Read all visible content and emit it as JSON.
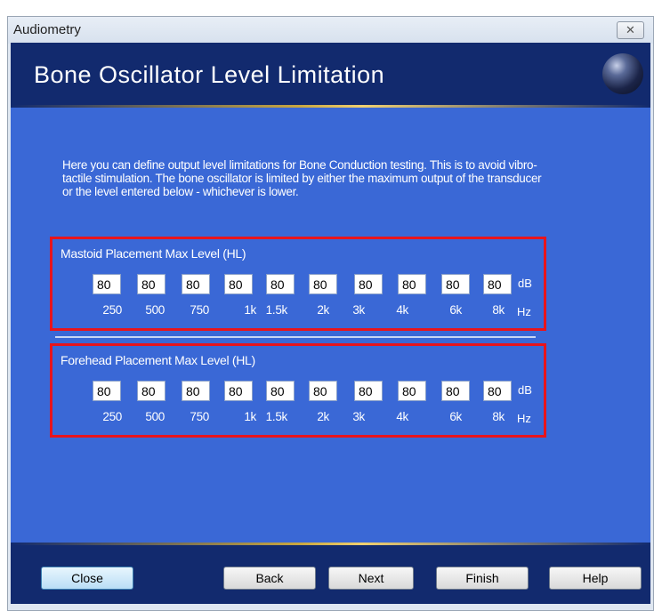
{
  "window": {
    "title": "Audiometry",
    "close_glyph": "✕"
  },
  "header": {
    "title": "Bone Oscillator Level Limitation"
  },
  "description": "Here you can define output level limitations for Bone Conduction testing. This is to avoid vibro-tactile stimulation. The bone oscillator is limited by either the maximum output of the transducer or the level entered below - whichever is lower.",
  "mastoid": {
    "label": "Mastoid Placement Max Level (HL)",
    "values": [
      "80",
      "80",
      "80",
      "80",
      "80",
      "80",
      "80",
      "80",
      "80",
      "80"
    ],
    "unit": "dB"
  },
  "forehead": {
    "label": "Forehead Placement Max Level (HL)",
    "values": [
      "80",
      "80",
      "80",
      "80",
      "80",
      "80",
      "80",
      "80",
      "80",
      "80"
    ],
    "unit": "dB"
  },
  "frequencies": [
    "250",
    "500",
    "750",
    "1k",
    "1.5k",
    "2k",
    "3k",
    "4k",
    "6k",
    "8k"
  ],
  "freq_unit": "Hz",
  "buttons": {
    "close": "Close",
    "back": "Back",
    "next": "Next",
    "finish": "Finish",
    "help": "Help"
  },
  "colors": {
    "header": "#122a6e",
    "content": "#3a68d6",
    "highlight_border": "#e8141c"
  }
}
